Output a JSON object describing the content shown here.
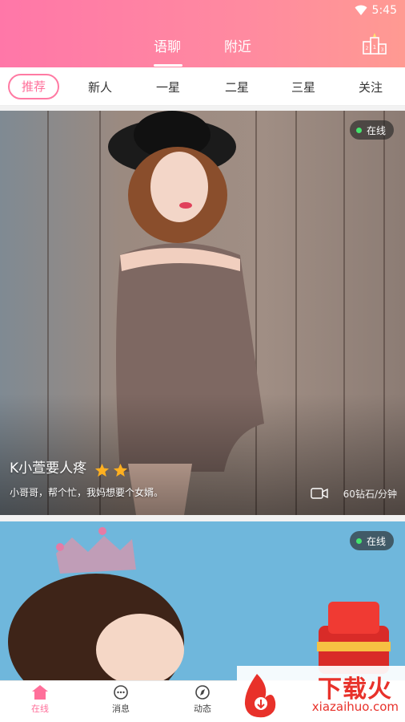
{
  "status_bar": {
    "time": "5:45",
    "icons": [
      "wifi-icon"
    ]
  },
  "header": {
    "tabs": [
      {
        "label": "语聊",
        "active": true
      },
      {
        "label": "附近",
        "active": false
      }
    ],
    "rank_icon": "leaderboard-icon"
  },
  "filters": {
    "items": [
      "推荐",
      "新人",
      "一星",
      "二星",
      "三星",
      "关注"
    ],
    "active": "推荐"
  },
  "cards": [
    {
      "status": "在线",
      "name": "K小萱要人疼",
      "stars": 2,
      "description": "小哥哥，帮个忙，我妈想要个女婿。",
      "price": "60钻石/分钟"
    },
    {
      "status": "在线"
    }
  ],
  "bottom_nav": {
    "items": [
      {
        "label": "在线",
        "icon": "home-icon",
        "active": true
      },
      {
        "label": "消息",
        "icon": "chat-icon",
        "active": false
      },
      {
        "label": "动态",
        "icon": "compass-icon",
        "active": false
      }
    ]
  },
  "watermark": {
    "text": "下载火",
    "url": "xiazaihuo.com"
  },
  "colors": {
    "accent": "#ff6f9a",
    "header_start": "#ff77a8",
    "header_end": "#ff9a92",
    "online": "#44e36d",
    "star": "#ffb020"
  }
}
